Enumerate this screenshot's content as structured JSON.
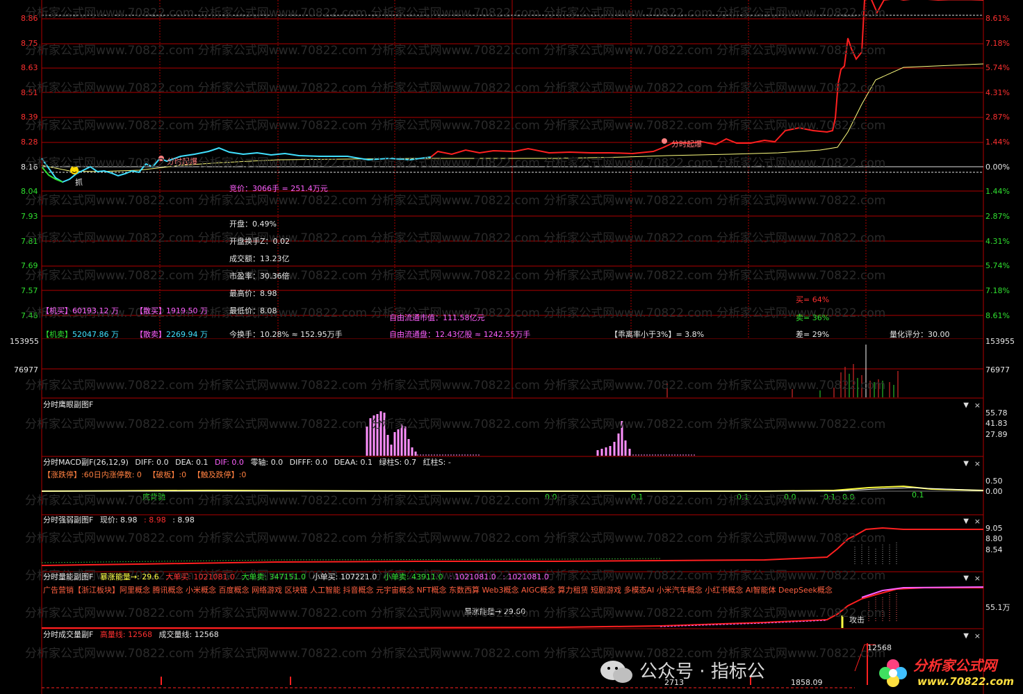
{
  "price_axis": {
    "left": [
      "8.86",
      "8.75",
      "8.63",
      "8.51",
      "8.39",
      "8.28",
      "8.16",
      "8.04",
      "7.93",
      "7.81",
      "7.69",
      "7.57",
      "7.46"
    ],
    "right": [
      "8.61%",
      "7.18%",
      "5.74%",
      "4.31%",
      "2.87%",
      "1.44%",
      "0.00%",
      "1.44%",
      "2.87%",
      "4.31%",
      "5.74%",
      "7.18%",
      "8.61%"
    ],
    "colors": {
      "up": "#ff3030",
      "flat": "#e8e8e8",
      "down": "#30e030"
    }
  },
  "watermark": "分析家公式网www.70822.com 分析家公式网www.70822.com 分析家公式网www.70822.com 分析家公式网www.70822.com 分析家公式网www.70822.com",
  "markers": {
    "grab": "抓",
    "surge1": "分时起爆",
    "surge2": "分时起爆"
  },
  "info": {
    "bid": "竞价：3066手 = 251.4万元",
    "open": "开盘：0.49%",
    "open_turnover": "开盘换手Z：0.02",
    "amount": "成交额：13.23亿",
    "pe": "市盈率：30.36倍",
    "high": "最高价：8.98",
    "low": "最低价：8.08",
    "inst_buy_tag": "【机买】",
    "inst_buy_val": "60193.12 万",
    "retail_buy_tag": "【散买】",
    "retail_buy_val": "1919.50 万",
    "inst_sell_tag": "【机卖】",
    "inst_sell_val": "52047.86 万",
    "retail_sell_tag": "【散卖】",
    "retail_sell_val": "2269.94 万",
    "turnover": "今换手：10.28% ≈ 152.95万手",
    "float_value": "自由流通市值：111.58亿元",
    "float_shares": "自由流通盘：12.43亿股 ≈ 1242.55万手",
    "deviation": "【乖离率小于3%】= 3.8%",
    "buy_pct": "买= 64%",
    "sell_pct": "卖= 36%",
    "diff_pct": "差= 29%",
    "score": "量化评分：30.00"
  },
  "volume_axis": {
    "left": [
      "153955",
      "76977"
    ],
    "right": [
      "153955",
      "76977"
    ]
  },
  "panels": {
    "eagle": {
      "title": "分时鹰眼副图F",
      "axis": [
        "55.78",
        "41.83",
        "27.89"
      ]
    },
    "macd": {
      "title": "分时MACD副F(26,12,9)",
      "diff": "DIFF: 0.0",
      "dea": "DEA: 0.1",
      "dif": "DIF: 0.0",
      "zero": "零轴: 0.0",
      "difff": "DIFFF: 0.0",
      "deaa": "DEAA: 0.1",
      "green": "绿柱S: 0.7",
      "red": "红柱S: -",
      "line2_a": "【涨跌停】:60日内涨停数: 0",
      "line2_b": "【破板】:0",
      "line2_c": "【触及跌停】:0",
      "axis": [
        "0.50",
        "0.00"
      ],
      "labels": [
        "底背驰",
        "0.0",
        "0.1",
        "0.1",
        "0.0",
        "0.1",
        "0.0",
        "0.1"
      ]
    },
    "strength": {
      "title": "分时强弱副图F",
      "price": "现价: 8.98",
      "v2": ": 8.98",
      "v3": ": 8.98",
      "axis": [
        "9.05",
        "8.80",
        "8.54"
      ]
    },
    "energy": {
      "title": "分时量能副图F",
      "surge": "暴涨能量→: 29.6",
      "big_buy": "大单买: 1021081.0",
      "big_sell": "大单卖: 347151.0",
      "small_buy": "小单买: 107221.0",
      "small_sell": "小单卖: 43911.0",
      "v1": ": 1021081.0",
      "v2": ": 1021081.0",
      "concepts": "广告营销【浙江板块】阿里概念 腾讯概念 小米概念 百度概念 网络游戏 区块链 人工智能 抖音概念 元宇宙概念 NFT概念 东数西算 Web3概念 AIGC概念 算力租赁 短剧游戏 多模态AI 小米汽车概念 小红书概念 AI智能体 DeepSeek概念",
      "center": "暴涨能量→ 29.60",
      "attack": "攻击",
      "axis": [
        "55.1万"
      ]
    },
    "volume": {
      "title": "分时成交量副F",
      "high": "高量线: 12568",
      "vol": "成交量线: 12568",
      "peak": "12568",
      "small1": "2713",
      "small2": "1858.09"
    }
  },
  "footer": {
    "wechat": "公众号 · 指标公",
    "logo": "分析家公式网",
    "url": "www.70822.com"
  },
  "ctrl": {
    "down": "▼",
    "close": "×"
  }
}
